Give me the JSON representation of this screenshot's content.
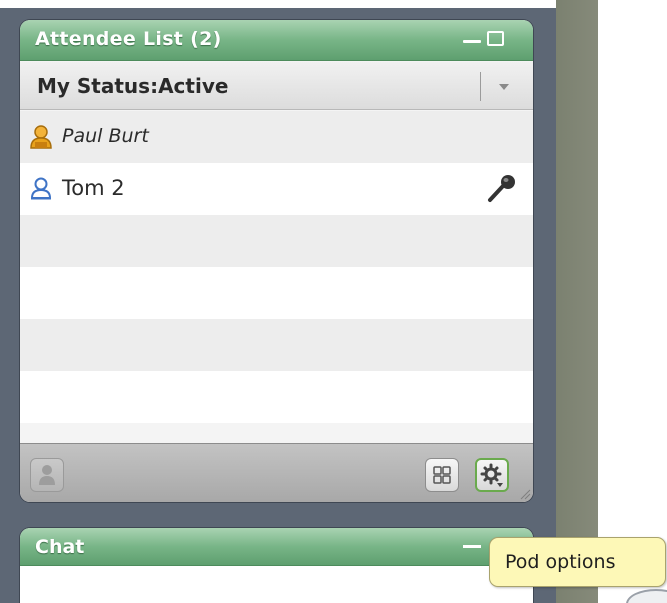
{
  "attendee_pod": {
    "title": "Attendee List (2)",
    "status": "My Status:Active",
    "attendees": [
      {
        "name": "Paul Burt",
        "role": "host",
        "icon": "host-person-icon"
      },
      {
        "name": "Tom 2",
        "role": "participant",
        "icon": "participant-person-icon",
        "has_mic": true
      }
    ]
  },
  "chat_pod": {
    "title": "Chat"
  },
  "tooltip": {
    "text": "Pod options"
  },
  "colors": {
    "header_green": "#78b587",
    "tooltip_bg": "#fdf8b7",
    "host_icon": "#e8a21c",
    "participant_icon": "#3f74c6"
  }
}
